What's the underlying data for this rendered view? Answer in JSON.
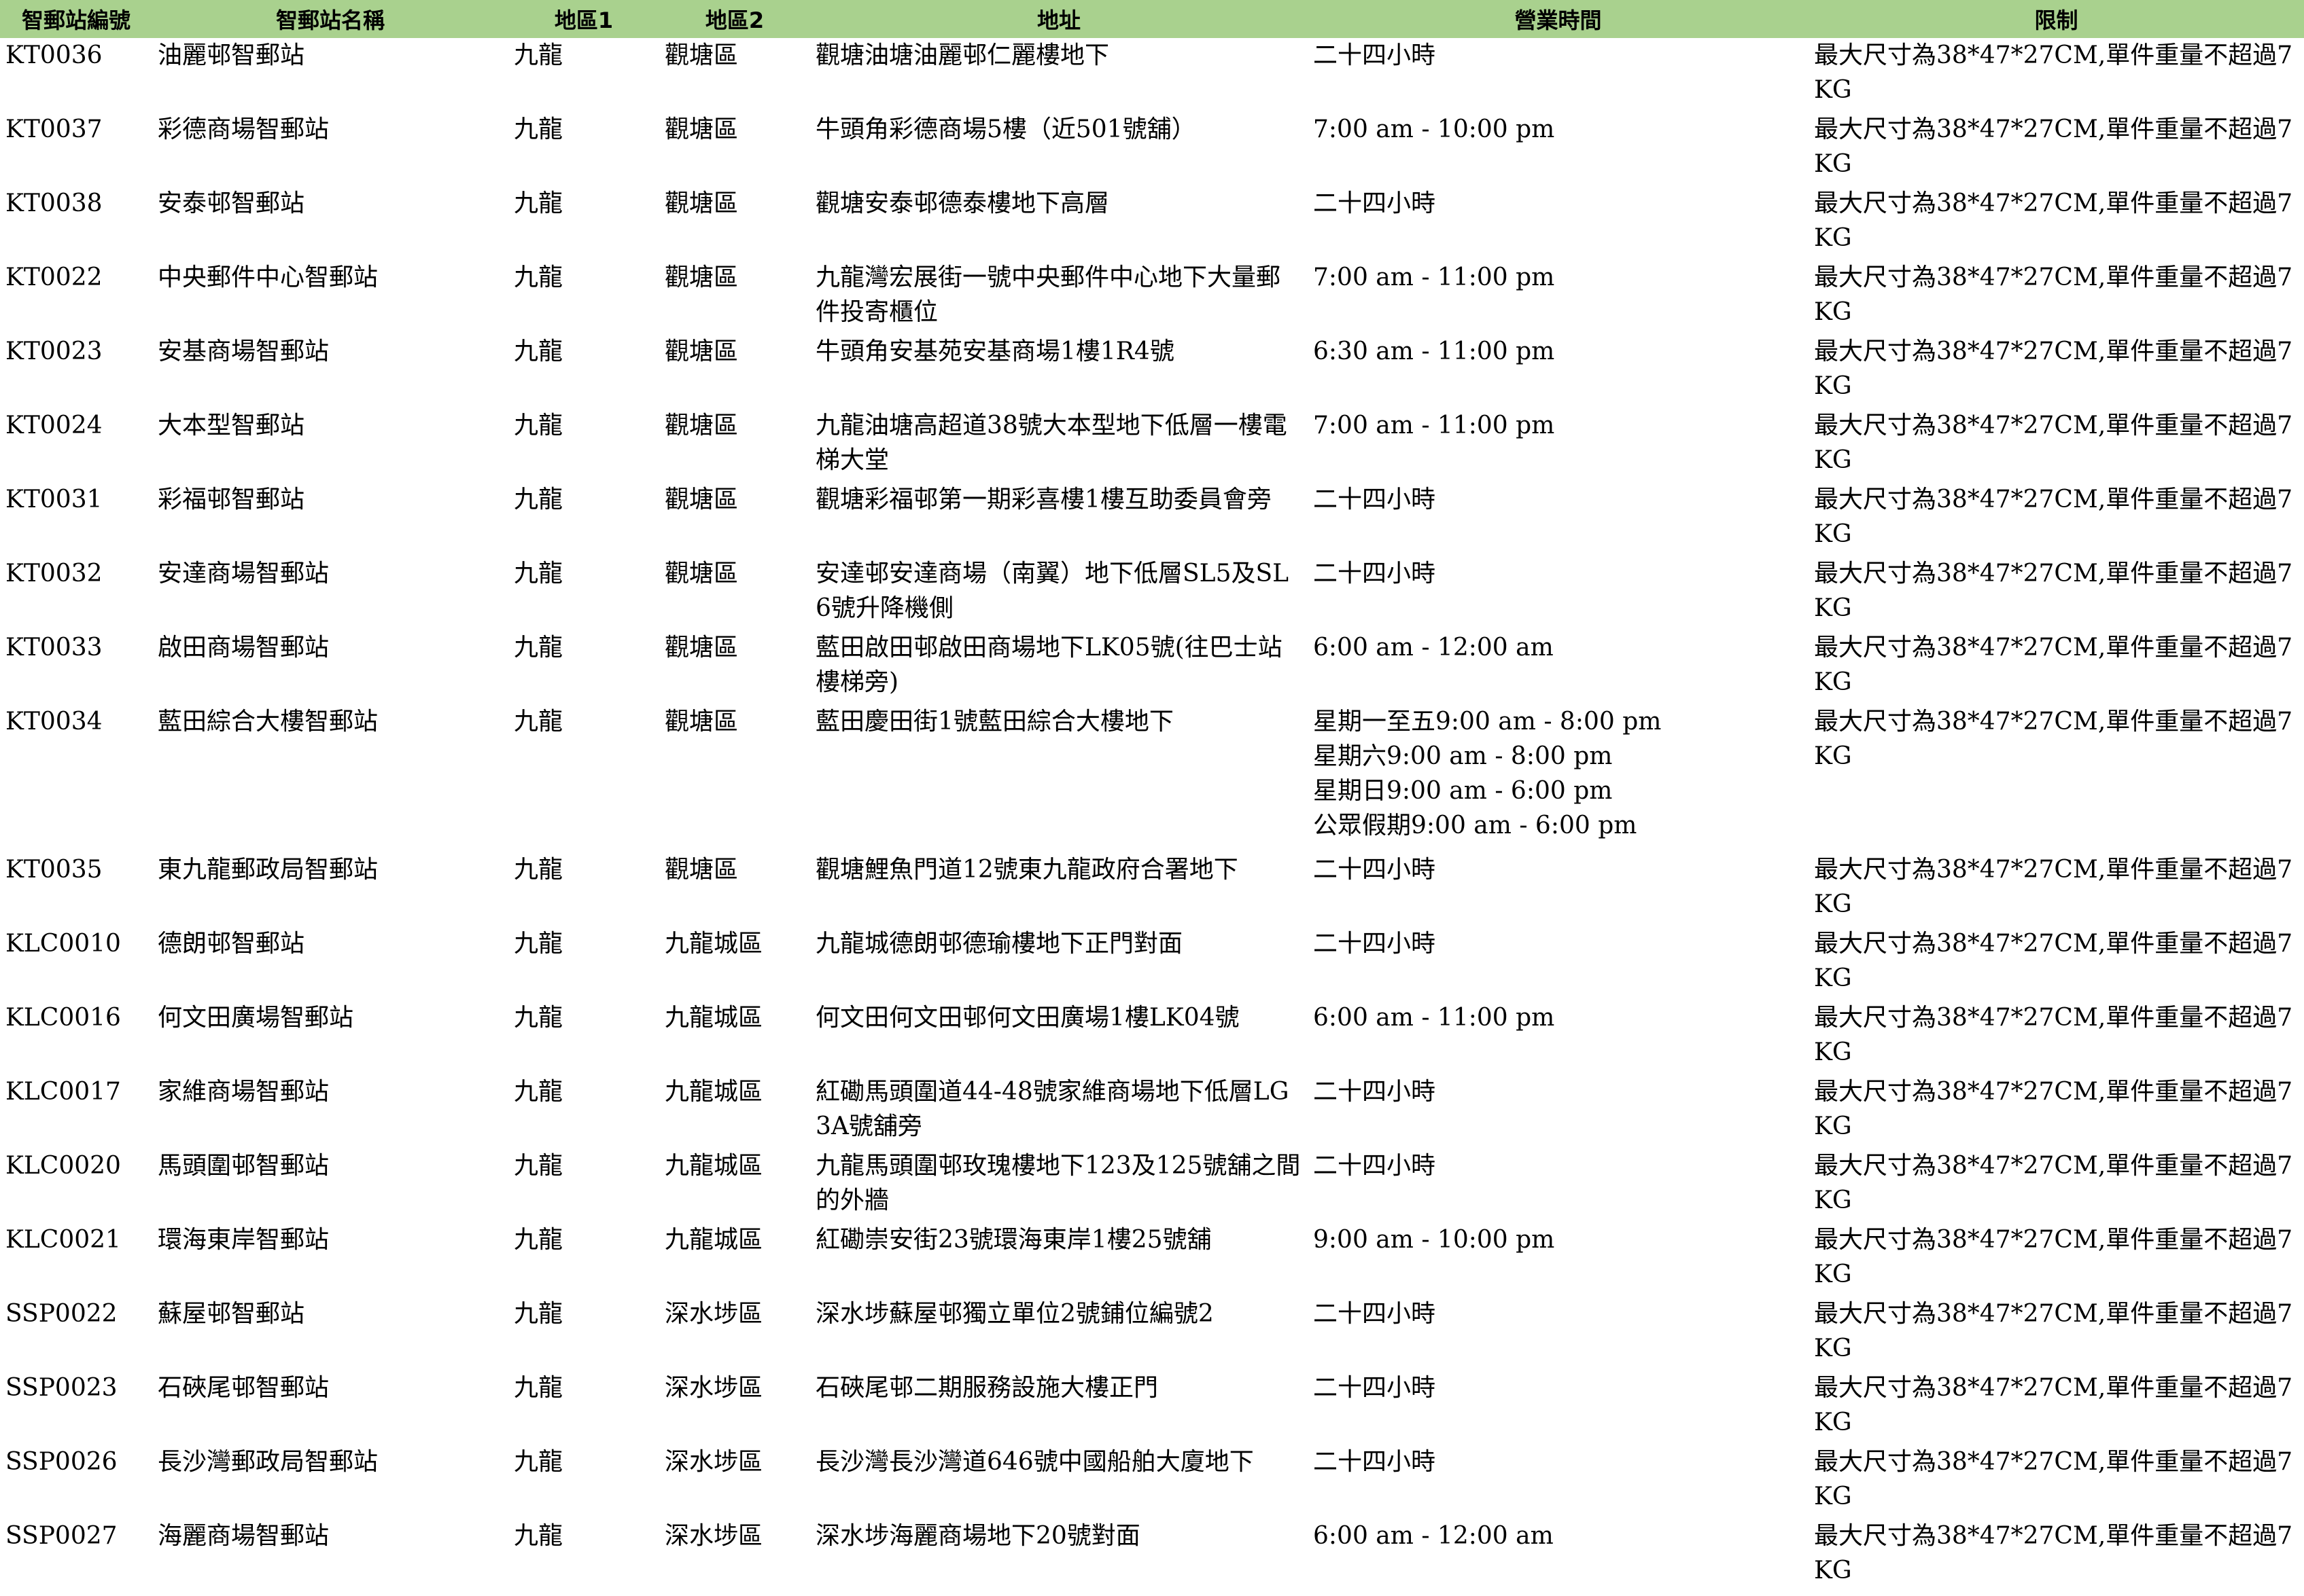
{
  "columns": [
    "智郵站編號",
    "智郵站名稱",
    "地區1",
    "地區2",
    "地址",
    "營業時間",
    "限制"
  ],
  "rows": [
    {
      "id": "KT0036",
      "name": "油麗邨智郵站",
      "region1": "九龍",
      "region2": "觀塘區",
      "address": "觀塘油塘油麗邨仁麗樓地下",
      "hours": [
        "二十四小時"
      ],
      "limit": "最大尺寸為38*47*27CM,單件重量不超過7KG"
    },
    {
      "id": "KT0037",
      "name": "彩德商場智郵站",
      "region1": "九龍",
      "region2": "觀塘區",
      "address": "牛頭角彩德商場5樓（近501號舖）",
      "hours": [
        "7:00 am - 10:00 pm"
      ],
      "limit": "最大尺寸為38*47*27CM,單件重量不超過7KG"
    },
    {
      "id": "KT0038",
      "name": "安泰邨智郵站",
      "region1": "九龍",
      "region2": "觀塘區",
      "address": "觀塘安泰邨德泰樓地下高層",
      "hours": [
        "二十四小時"
      ],
      "limit": "最大尺寸為38*47*27CM,單件重量不超過7KG"
    },
    {
      "id": "KT0022",
      "name": "中央郵件中心智郵站",
      "region1": "九龍",
      "region2": "觀塘區",
      "address": "九龍灣宏展街一號中央郵件中心地下大量郵件投寄櫃位",
      "hours": [
        "7:00 am - 11:00 pm"
      ],
      "limit": "最大尺寸為38*47*27CM,單件重量不超過7KG"
    },
    {
      "id": "KT0023",
      "name": "安基商場智郵站",
      "region1": "九龍",
      "region2": "觀塘區",
      "address": "牛頭角安基苑安基商場1樓1R4號",
      "hours": [
        "6:30 am - 11:00 pm"
      ],
      "limit": "最大尺寸為38*47*27CM,單件重量不超過7KG"
    },
    {
      "id": "KT0024",
      "name": "大本型智郵站",
      "region1": "九龍",
      "region2": "觀塘區",
      "address": "九龍油塘高超道38號大本型地下低層一樓電梯大堂",
      "hours": [
        "7:00 am - 11:00 pm"
      ],
      "limit": "最大尺寸為38*47*27CM,單件重量不超過7KG"
    },
    {
      "id": "KT0031",
      "name": "彩福邨智郵站",
      "region1": "九龍",
      "region2": "觀塘區",
      "address": "觀塘彩福邨第一期彩喜樓1樓互助委員會旁",
      "hours": [
        "二十四小時"
      ],
      "limit": "最大尺寸為38*47*27CM,單件重量不超過7KG"
    },
    {
      "id": "KT0032",
      "name": "安達商場智郵站",
      "region1": "九龍",
      "region2": "觀塘區",
      "address": "安達邨安達商場（南翼）地下低層SL5及SL6號升降機側",
      "hours": [
        "二十四小時"
      ],
      "limit": "最大尺寸為38*47*27CM,單件重量不超過7KG"
    },
    {
      "id": "KT0033",
      "name": "啟田商場智郵站",
      "region1": "九龍",
      "region2": "觀塘區",
      "address": "藍田啟田邨啟田商場地下LK05號(往巴士站樓梯旁)",
      "hours": [
        "6:00 am - 12:00 am"
      ],
      "limit": "最大尺寸為38*47*27CM,單件重量不超過7KG"
    },
    {
      "id": "KT0034",
      "name": "藍田綜合大樓智郵站",
      "region1": "九龍",
      "region2": "觀塘區",
      "address": "藍田慶田街1號藍田綜合大樓地下",
      "hours": [
        "星期一至五9:00 am - 8:00 pm",
        "星期六9:00 am - 8:00 pm",
        "星期日9:00 am - 6:00 pm",
        "公眾假期9:00 am - 6:00 pm"
      ],
      "limit": "最大尺寸為38*47*27CM,單件重量不超過7KG"
    },
    {
      "id": "KT0035",
      "name": "東九龍郵政局智郵站",
      "region1": "九龍",
      "region2": "觀塘區",
      "address": "觀塘鯉魚門道12號東九龍政府合署地下",
      "hours": [
        "二十四小時"
      ],
      "limit": "最大尺寸為38*47*27CM,單件重量不超過7KG"
    },
    {
      "id": "KLC0010",
      "name": "德朗邨智郵站",
      "region1": "九龍",
      "region2": "九龍城區",
      "address": "九龍城德朗邨德瑜樓地下正門對面",
      "hours": [
        "二十四小時"
      ],
      "limit": "最大尺寸為38*47*27CM,單件重量不超過7KG"
    },
    {
      "id": "KLC0016",
      "name": "何文田廣場智郵站",
      "region1": "九龍",
      "region2": "九龍城區",
      "address": "何文田何文田邨何文田廣場1樓LK04號",
      "hours": [
        "6:00 am - 11:00 pm"
      ],
      "limit": "最大尺寸為38*47*27CM,單件重量不超過7KG"
    },
    {
      "id": "KLC0017",
      "name": "家維商場智郵站",
      "region1": "九龍",
      "region2": "九龍城區",
      "address": "紅磡馬頭圍道44-48號家維商場地下低層LG3A號舖旁",
      "hours": [
        "二十四小時"
      ],
      "limit": "最大尺寸為38*47*27CM,單件重量不超過7KG"
    },
    {
      "id": "KLC0020",
      "name": "馬頭圍邨智郵站",
      "region1": "九龍",
      "region2": "九龍城區",
      "address": "九龍馬頭圍邨玫瑰樓地下123及125號舖之間的外牆",
      "hours": [
        "二十四小時"
      ],
      "limit": "最大尺寸為38*47*27CM,單件重量不超過7KG"
    },
    {
      "id": "KLC0021",
      "name": "環海東岸智郵站",
      "region1": "九龍",
      "region2": "九龍城區",
      "address": "紅磡崇安街23號環海東岸1樓25號舖",
      "hours": [
        "9:00 am - 10:00 pm"
      ],
      "limit": "最大尺寸為38*47*27CM,單件重量不超過7KG"
    },
    {
      "id": "SSP0022",
      "name": "蘇屋邨智郵站",
      "region1": "九龍",
      "region2": "深水埗區",
      "address": "深水埗蘇屋邨獨立單位2號鋪位編號2",
      "hours": [
        "二十四小時"
      ],
      "limit": "最大尺寸為38*47*27CM,單件重量不超過7KG"
    },
    {
      "id": "SSP0023",
      "name": "石硤尾邨智郵站",
      "region1": "九龍",
      "region2": "深水埗區",
      "address": "石硤尾邨二期服務設施大樓正門",
      "hours": [
        "二十四小時"
      ],
      "limit": "最大尺寸為38*47*27CM,單件重量不超過7KG"
    },
    {
      "id": "SSP0026",
      "name": "長沙灣郵政局智郵站",
      "region1": "九龍",
      "region2": "深水埗區",
      "address": "長沙灣長沙灣道646號中國船舶大廈地下",
      "hours": [
        "二十四小時"
      ],
      "limit": "最大尺寸為38*47*27CM,單件重量不超過7KG"
    },
    {
      "id": "SSP0027",
      "name": "海麗商場智郵站",
      "region1": "九龍",
      "region2": "深水埗區",
      "address": "深水埗海麗商場地下20號對面",
      "hours": [
        "6:00 am - 12:00 am"
      ],
      "limit": "最大尺寸為38*47*27CM,單件重量不超過7KG"
    }
  ]
}
